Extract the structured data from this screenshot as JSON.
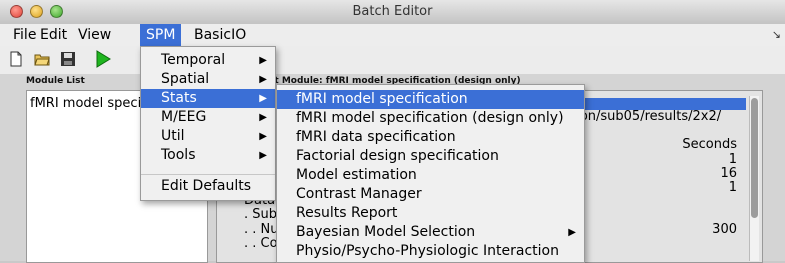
{
  "window": {
    "title": "Batch Editor"
  },
  "menubar": {
    "items": [
      "File",
      "Edit",
      "View",
      "SPM",
      "BasicIO"
    ],
    "active": "SPM"
  },
  "toolbar": {
    "icons": [
      "new-file-icon",
      "open-folder-icon",
      "save-icon",
      "run-icon"
    ]
  },
  "module_list": {
    "label": "Module List",
    "items": [
      "fMRI model speci"
    ]
  },
  "current_module": {
    "label": "Current Module: fMRI model specification (design only)",
    "path_value": "cation/sub05/results/2x2/",
    "right_values": [
      "Seconds",
      "1",
      "16",
      "1",
      "300"
    ],
    "tree_lines": [
      "Data",
      ". Sub",
      ". . Nu",
      ". . Co"
    ]
  },
  "spm_menu": {
    "items": [
      {
        "label": "Temporal",
        "submenu": true
      },
      {
        "label": "Spatial",
        "submenu": true
      },
      {
        "label": "Stats",
        "submenu": true,
        "active": true
      },
      {
        "label": "M/EEG",
        "submenu": true
      },
      {
        "label": "Util",
        "submenu": true
      },
      {
        "label": "Tools",
        "submenu": true
      },
      {
        "label": "Edit Defaults",
        "submenu": false
      }
    ]
  },
  "stats_submenu": {
    "items": [
      {
        "label": "fMRI model specification",
        "active": true
      },
      {
        "label": "fMRI model specification (design only)"
      },
      {
        "label": "fMRI data specification"
      },
      {
        "label": "Factorial design specification"
      },
      {
        "label": "Model estimation"
      },
      {
        "label": "Contrast Manager"
      },
      {
        "label": "Results Report"
      },
      {
        "label": "Bayesian Model Selection",
        "submenu": true
      },
      {
        "label": "Physio/Psycho-Physiologic Interaction"
      }
    ]
  },
  "colors": {
    "accent": "#3b6fd6",
    "menu_bg": "#f0f0f0"
  }
}
